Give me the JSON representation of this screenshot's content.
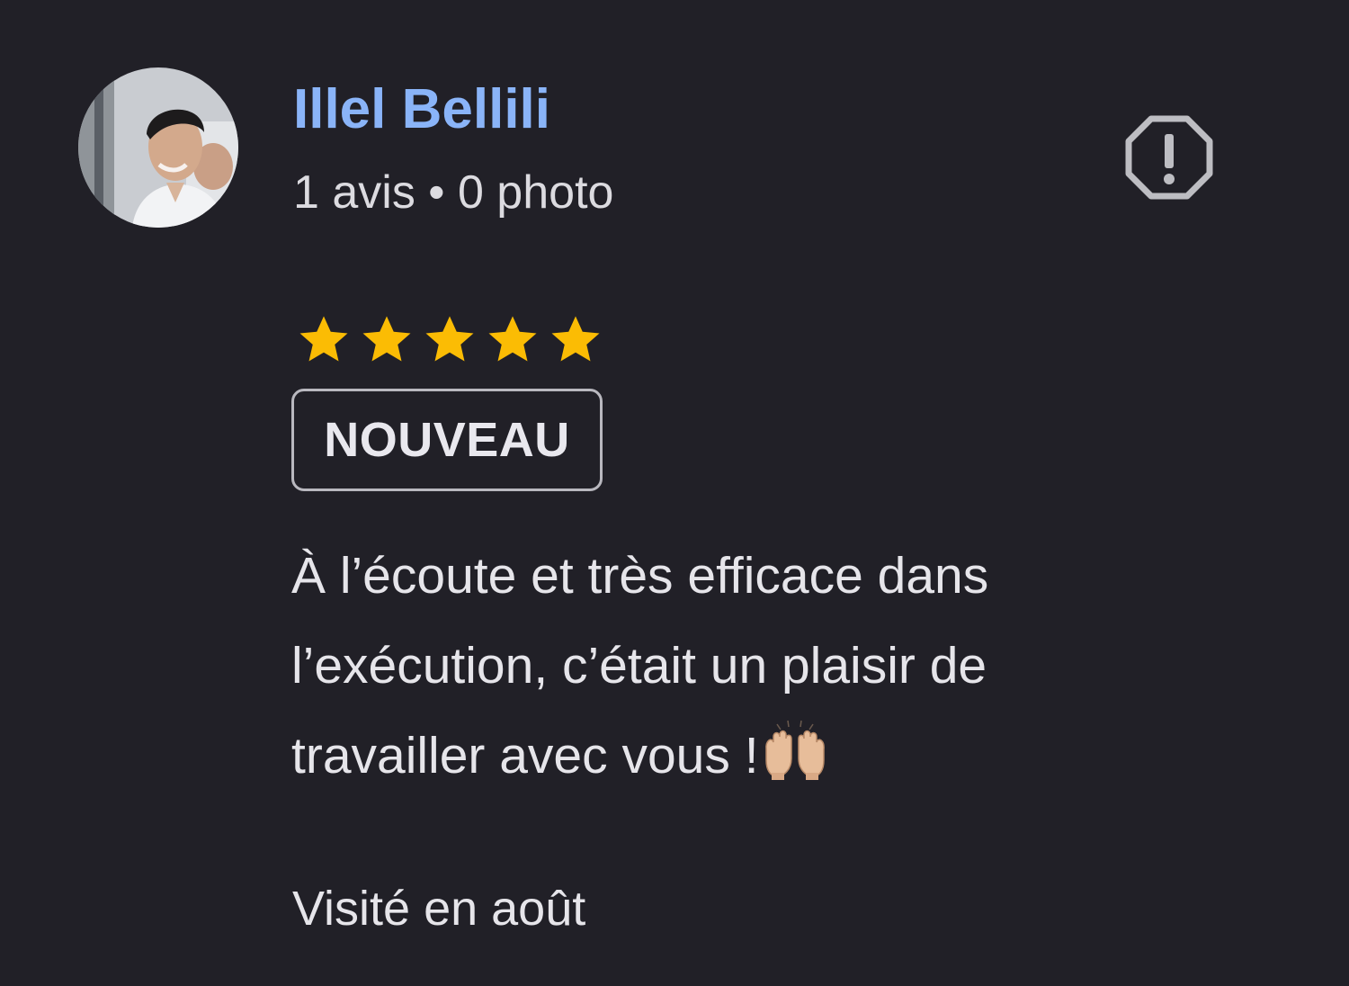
{
  "review": {
    "author": {
      "name": "Illel Bellili",
      "meta": "1 avis • 0 photo"
    },
    "rating": 5,
    "max_rating": 5,
    "badge": "NOUVEAU",
    "text_lines": [
      "À l’écoute et très efficace dans",
      "l’exécution, c’était un plaisir de",
      "travailler avec vous !"
    ],
    "emoji": "raising-hands-icon",
    "visit": "Visité en août",
    "report_icon": "report-icon"
  },
  "colors": {
    "background": "#212027",
    "name": "#8ab4f8",
    "star": "#fbbc04",
    "text": "#e6e5ea",
    "badge_border": "#b9b8bf",
    "icon": "#bdbdc2"
  }
}
